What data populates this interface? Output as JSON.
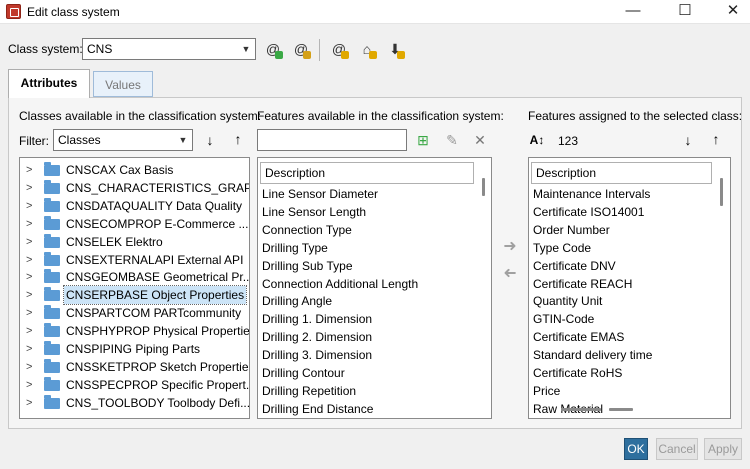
{
  "window": {
    "title": "Edit class system",
    "minimize_glyph": "—",
    "maximize_glyph": "☐",
    "close_glyph": "✕"
  },
  "class_system": {
    "label": "Class system:",
    "value": "CNS"
  },
  "toolbar_icons": [
    "add-class-system-icon",
    "edit-class-system-icon",
    "class-attributes-icon",
    "import-icon",
    "export-icon"
  ],
  "tabs": [
    {
      "label": "Attributes",
      "active": true
    },
    {
      "label": "Values",
      "active": false
    }
  ],
  "classes_panel": {
    "heading": "Classes available in the classification system:",
    "filter_label": "Filter:",
    "filter_value": "Classes",
    "selected_index": 7,
    "items": [
      "CNSCAX Cax Basis",
      "CNS_CHARACTERISTICS_GRAP...",
      "CNSDATAQUALITY Data Quality",
      "CNSECOMPROP E-Commerce ...",
      "CNSELEK Elektro",
      "CNSEXTERNALAPI External API",
      "CNSGEOMBASE Geometrical Pr...",
      "CNSERPBASE Object Properties",
      "CNSPARTCOM PARTcommunity",
      "CNSPHYPROP Physical Properties",
      "CNSPIPING Piping Parts",
      "CNSSKETPROP Sketch Properties",
      "CNSSPECPROP Specific Propert...",
      "CNS_TOOLBODY Toolbody Defi..."
    ]
  },
  "features_available": {
    "heading": "Features available in the classification system:",
    "search_value": "",
    "column_header": "Description",
    "items": [
      "Line Sensor Diameter",
      "Line Sensor Length",
      "Connection Type",
      "Drilling Type",
      "Drilling Sub Type",
      "Connection Additional Length",
      "Drilling Angle",
      "Drilling 1. Dimension",
      "Drilling 2. Dimension",
      "Drilling 3. Dimension",
      "Drilling Contour",
      "Drilling Repetition",
      "Drilling End Distance"
    ]
  },
  "features_assigned": {
    "heading": "Features assigned to the selected class:",
    "sort_label": "123",
    "column_header": "Description",
    "items": [
      "Maintenance Intervals",
      "Certificate ISO14001",
      "Order Number",
      "Type Code",
      "Certificate DNV",
      "Certificate REACH",
      "Quantity Unit",
      "GTIN-Code",
      "Certificate EMAS",
      "Standard delivery time",
      "Certificate RoHS",
      "Price",
      "Raw Material"
    ]
  },
  "buttons": {
    "ok": "OK",
    "cancel": "Cancel",
    "apply": "Apply"
  },
  "colors": {
    "accent": "#2e6f9e",
    "selection": "#cce4f7",
    "folder": "#5b9bd5"
  }
}
